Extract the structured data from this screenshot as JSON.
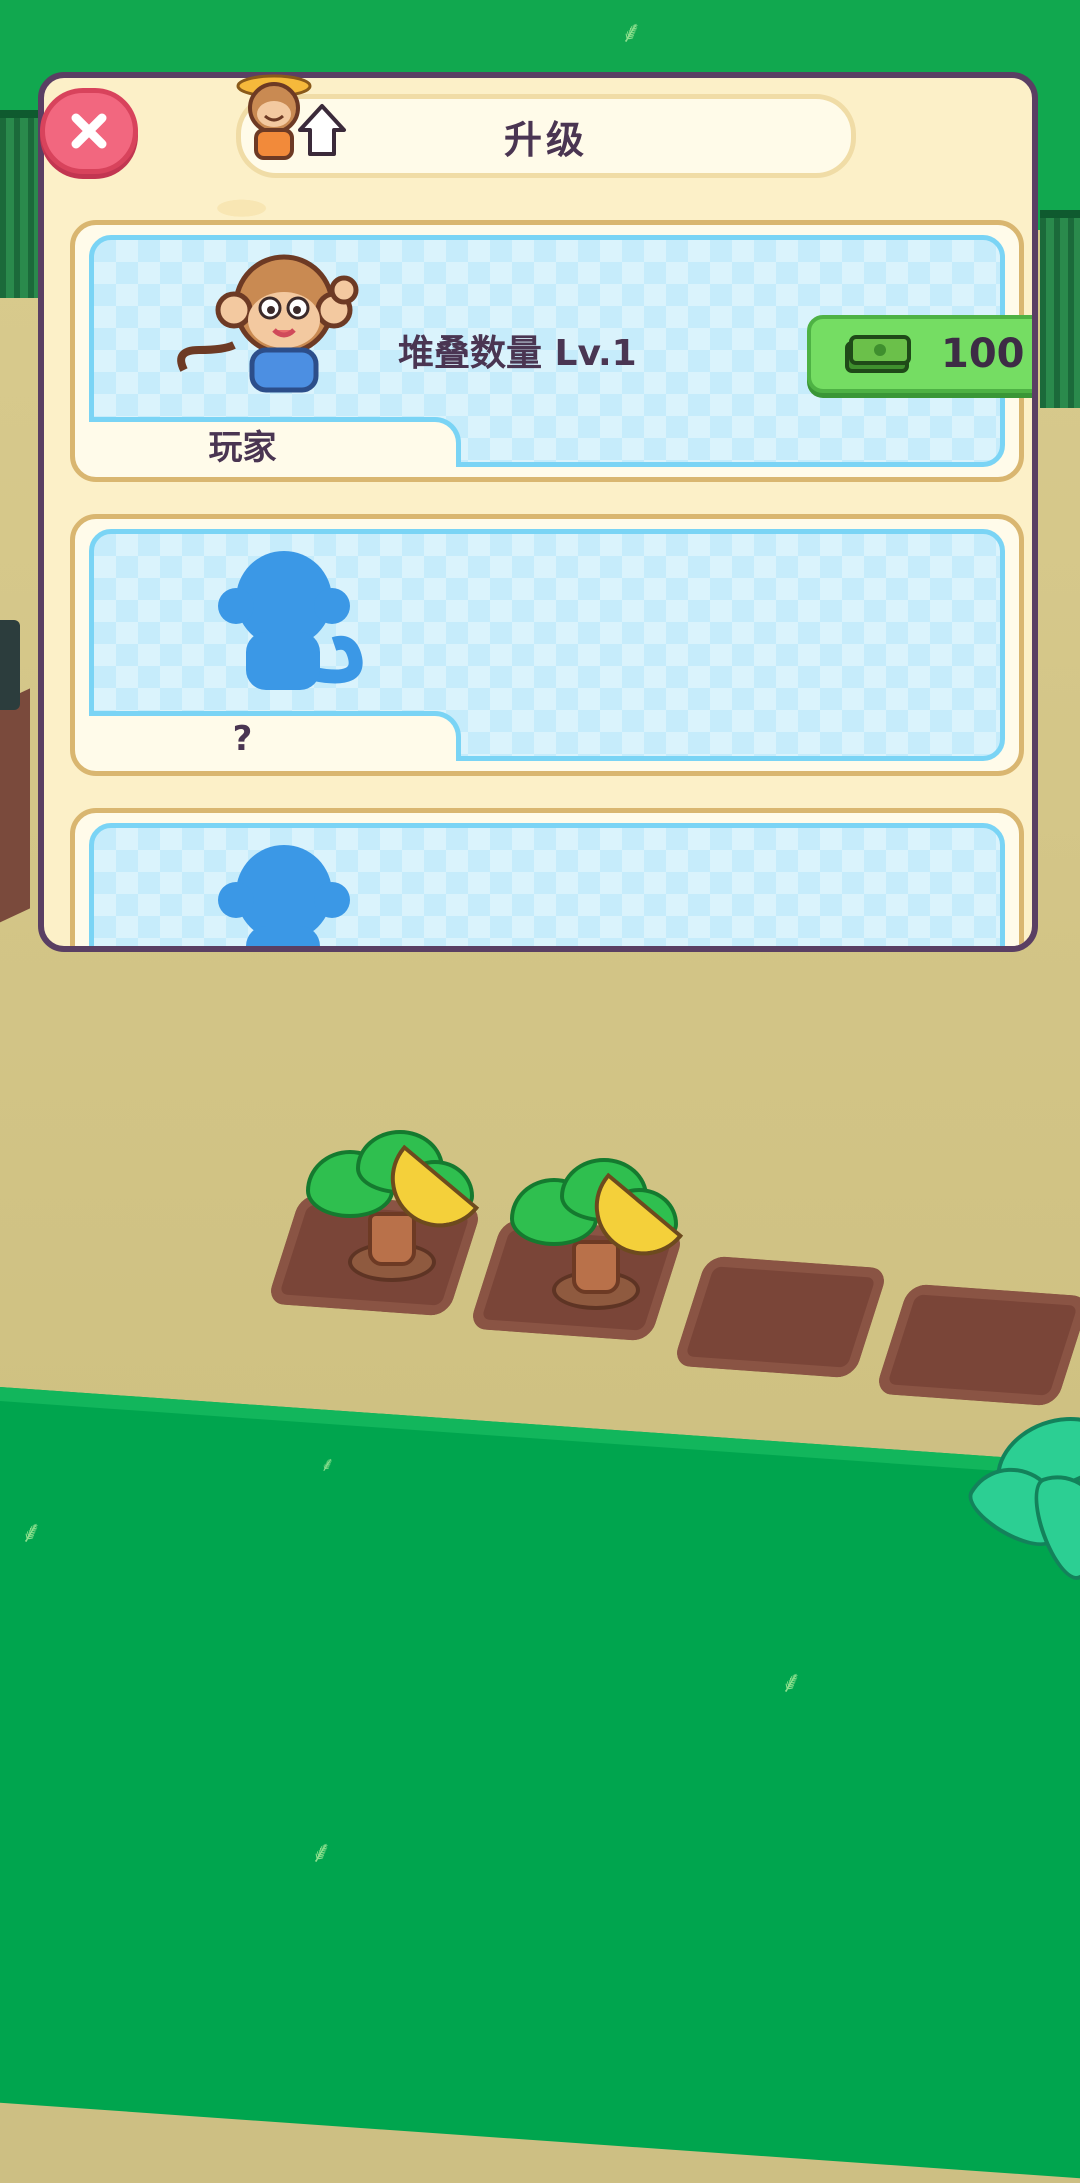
{
  "dialog": {
    "title": "升级"
  },
  "cards": [
    {
      "name": "玩家",
      "stat": "堆叠数量 Lv.1",
      "price": "100",
      "locked": false
    },
    {
      "name": "?",
      "locked": true
    },
    {
      "locked": true
    }
  ],
  "icons": {
    "close": "close-icon",
    "title": "monkey-upgrade-icon",
    "price": "cash-icon"
  },
  "colors": {
    "close_button": "#f2677f",
    "price_button": "#75dd63",
    "card_panel": "#c6ecfb",
    "silhouette": "#3b98e6",
    "text": "#4a3552"
  }
}
